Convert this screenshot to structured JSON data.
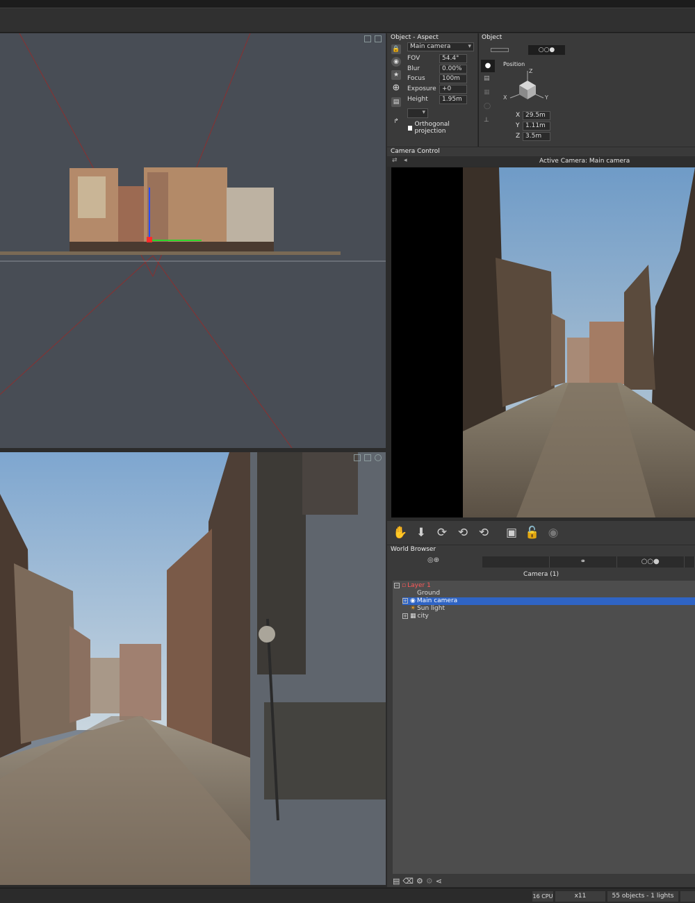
{
  "viewports": {
    "top_icons": [
      "cube-icon",
      "frame-icon"
    ],
    "bottom_icons": [
      "cube-icon",
      "frame-icon",
      "light-icon"
    ]
  },
  "aspect": {
    "title": "Object - Aspect",
    "camera_select": "Main camera",
    "fields": [
      {
        "label": "FOV",
        "value": "54.4°"
      },
      {
        "label": "Blur",
        "value": "0.00%"
      },
      {
        "label": "Focus",
        "value": "100m"
      },
      {
        "label": "Exposure",
        "value": "+0"
      },
      {
        "label": "Height",
        "value": "1.95m"
      }
    ],
    "ortho_label": "Orthogonal projection"
  },
  "object": {
    "title": "Object",
    "position_label": "Position",
    "axis_labels": {
      "x": "X",
      "y": "Y",
      "z": "Z"
    },
    "coords": [
      {
        "label": "X",
        "value": "29.5m"
      },
      {
        "label": "Y",
        "value": "1.11m"
      },
      {
        "label": "Z",
        "value": "3.5m"
      }
    ]
  },
  "camera_control": {
    "title": "Camera Control",
    "active": "Active Camera: Main camera"
  },
  "world_browser": {
    "title": "World Browser",
    "tab_label": "Camera (1)",
    "tree": [
      {
        "label": "Layer 1"
      },
      {
        "label": "Ground"
      },
      {
        "label": "Main camera"
      },
      {
        "label": "Sun light"
      },
      {
        "label": "city"
      }
    ]
  },
  "status": {
    "cpu": "16 CPU",
    "mult": "x11",
    "objects": "55 objects - 1 lights"
  },
  "colors": {
    "selection": "#2f64c4",
    "panel": "#3a3a3a",
    "viewport": "#484d55",
    "layer_red": "#ff5a5a"
  }
}
